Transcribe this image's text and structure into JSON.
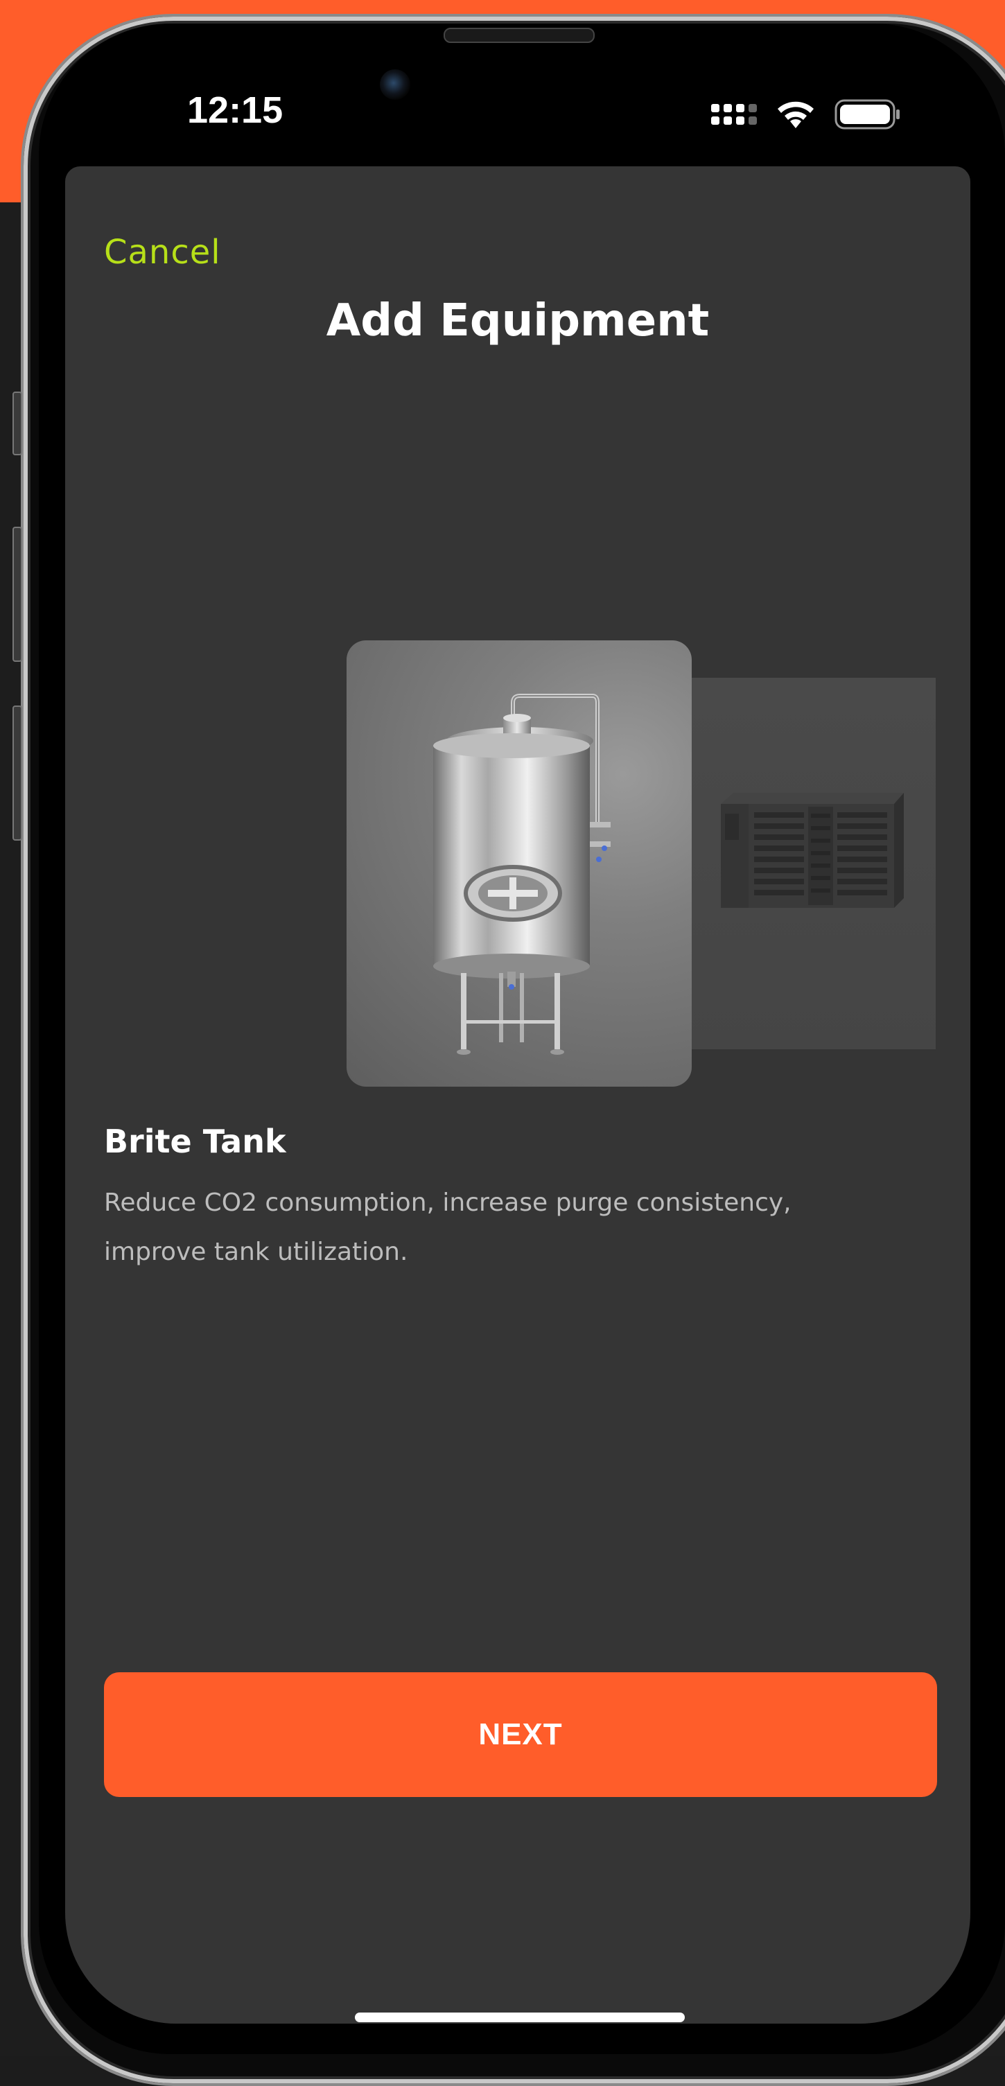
{
  "status_bar": {
    "time": "12:15"
  },
  "header": {
    "cancel_label": "Cancel",
    "title": "Add Equipment"
  },
  "carousel": {
    "items": [
      {
        "name": "Brite Tank",
        "image": "brite-tank-icon"
      },
      {
        "name": "",
        "image": "condensing-unit-icon"
      }
    ]
  },
  "selected_equipment": {
    "name": "Brite Tank",
    "description": "Reduce CO2 consumption, increase purge consistency, improve tank utilization."
  },
  "footer": {
    "next_label": "NEXT"
  },
  "colors": {
    "accent": "#ff5d2a",
    "link": "#b7e019",
    "sheet_background": "#353535"
  }
}
